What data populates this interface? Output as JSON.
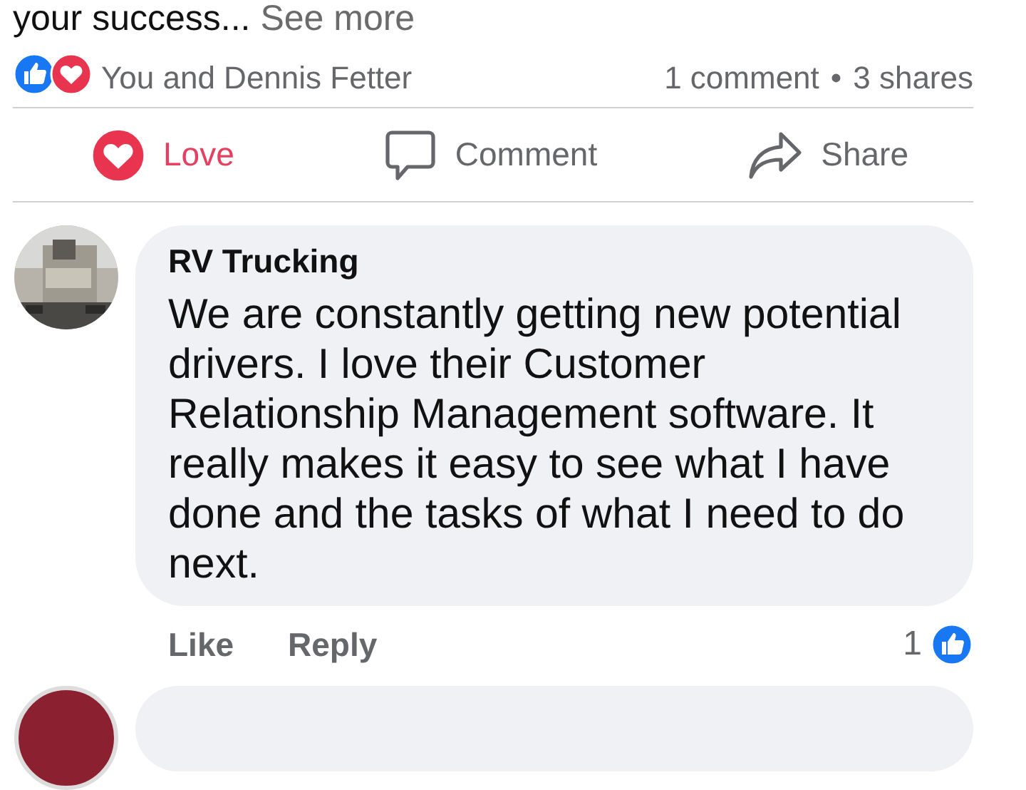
{
  "post_text": {
    "text": "your success...",
    "see_more": "See more"
  },
  "reactions": {
    "summary": "You and Dennis Fetter",
    "comments": "1 comment",
    "separator": "•",
    "shares": "3 shares"
  },
  "actions": [
    {
      "kind": "love",
      "label": "Love",
      "selected": true
    },
    {
      "kind": "comment",
      "label": "Comment",
      "selected": false
    },
    {
      "kind": "share",
      "label": "Share",
      "selected": false
    }
  ],
  "comments": [
    {
      "author": "RV Trucking",
      "text": "We are constantly getting new potential drivers. I love their Customer Relationship Management software. It really makes it easy to see what I have done and the tasks of what I need to do next.",
      "like": "Like",
      "reply": "Reply",
      "like_count": "1"
    }
  ]
}
